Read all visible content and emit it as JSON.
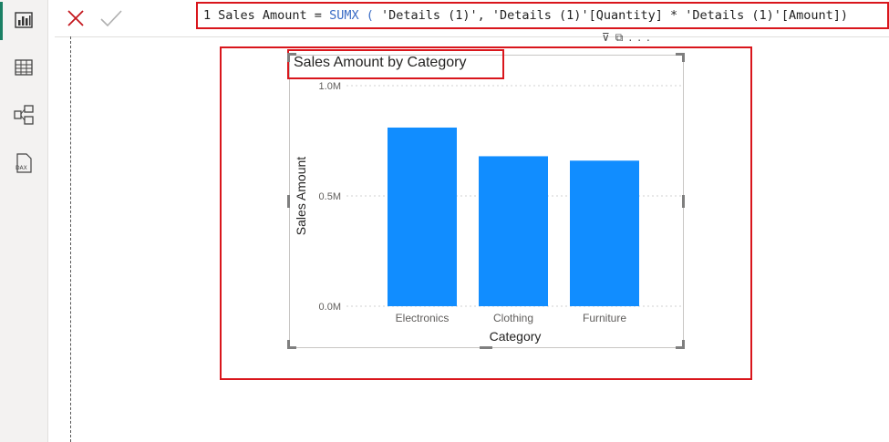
{
  "sidebar": {
    "items": [
      {
        "icon": "report-view-icon",
        "active": true
      },
      {
        "icon": "table-view-icon",
        "active": false
      },
      {
        "icon": "model-view-icon",
        "active": false
      },
      {
        "icon": "dax-query-view-icon",
        "label": "DAX",
        "active": false
      }
    ]
  },
  "formula_bar": {
    "cancel_icon": "close-icon",
    "commit_icon": "checkmark-icon",
    "line_number": "1",
    "tokens": [
      {
        "text": "Sales Amount = ",
        "cls": ""
      },
      {
        "text": "SUMX",
        "cls": "fn"
      },
      {
        "text": " ( ",
        "cls": "fn"
      },
      {
        "text": "'Details (1)'",
        "cls": ""
      },
      {
        "text": ", ",
        "cls": ""
      },
      {
        "text": "'Details (1)'[Quantity]",
        "cls": ""
      },
      {
        "text": " * ",
        "cls": ""
      },
      {
        "text": "'Details (1)'[Amount]",
        "cls": ""
      },
      {
        "text": ")",
        "cls": ""
      }
    ]
  },
  "visual_toolbar": {
    "icons": [
      "filter-icon",
      "focus-mode-icon",
      "more-options-icon"
    ],
    "more": "..."
  },
  "chart_data": {
    "type": "bar",
    "title": "Sales Amount by Category",
    "xlabel": "Category",
    "ylabel": "Sales Amount",
    "categories": [
      "Electronics",
      "Clothing",
      "Furniture"
    ],
    "values": [
      0.81,
      0.68,
      0.66
    ],
    "unit": "M",
    "yticks": [
      "0.0M",
      "0.5M",
      "1.0M"
    ],
    "ytick_values": [
      0,
      0.5,
      1.0
    ],
    "ylim": [
      0,
      1.0
    ],
    "grid": true,
    "bar_color": "#118dff"
  },
  "colors": {
    "highlight": "#d9161c",
    "accent": "#1a7f64"
  }
}
